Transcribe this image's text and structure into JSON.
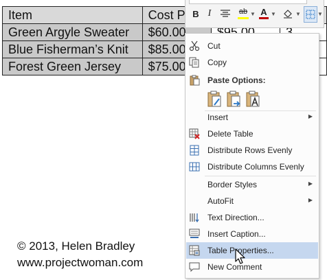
{
  "table": {
    "rows": [
      [
        "Item",
        "Cost P",
        "",
        ""
      ],
      [
        "Green Argyle Sweater",
        "$60.00",
        "$95.00",
        "3"
      ],
      [
        "Blue Fisherman’s Knit",
        "$85.00",
        "",
        ""
      ],
      [
        "Forest Green Jersey",
        "$75.00",
        "",
        ""
      ]
    ]
  },
  "mini_toolbar": {
    "bold": "B",
    "italic": "I",
    "highlight": "ab",
    "font_color": "A",
    "highlight_color": "#ffff00",
    "font_color_value": "#c00000",
    "accent": "#2b78c6"
  },
  "context_menu": {
    "cut": "Cut",
    "copy": "Copy",
    "paste_options": "Paste Options:",
    "insert": "Insert",
    "delete_table": "Delete Table",
    "distribute_rows": "Distribute Rows Evenly",
    "distribute_columns": "Distribute Columns Evenly",
    "border_styles": "Border Styles",
    "autofit": "AutoFit",
    "text_direction": "Text Direction...",
    "insert_caption": "Insert Caption...",
    "table_properties": "Table Properties...",
    "new_comment": "New Comment"
  },
  "watermark": {
    "line1": "© 2013, Helen Bradley",
    "line2": "www.projectwoman.com"
  }
}
